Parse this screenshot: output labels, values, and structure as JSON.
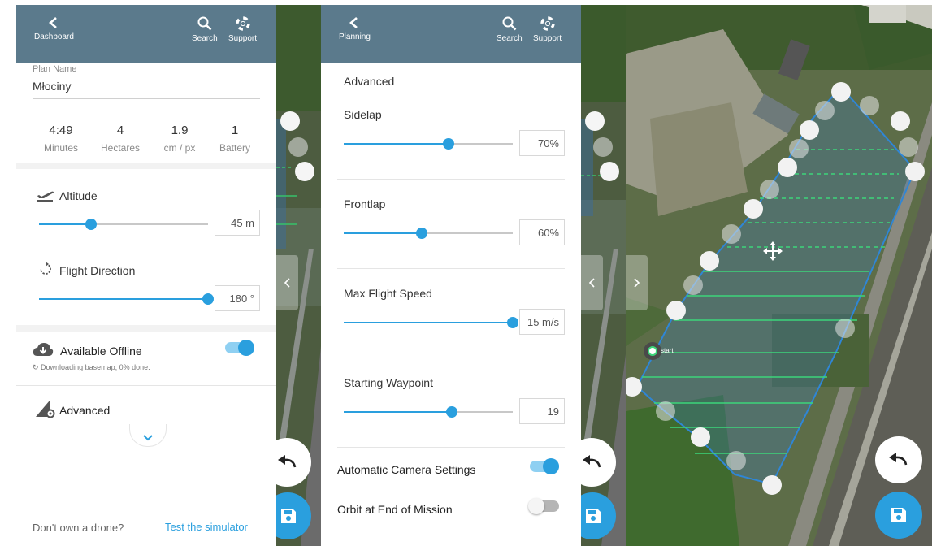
{
  "panel1": {
    "header": {
      "back_label": "Dashboard",
      "search_label": "Search",
      "support_label": "Support"
    },
    "plan_name_label": "Plan Name",
    "plan_name_value": "Młociny",
    "stats": [
      {
        "value": "4:49",
        "label": "Minutes"
      },
      {
        "value": "4",
        "label": "Hectares"
      },
      {
        "value": "1.9",
        "label": "cm / px"
      },
      {
        "value": "1",
        "label": "Battery"
      }
    ],
    "altitude": {
      "label": "Altitude",
      "value": "45 m",
      "fraction": 0.31
    },
    "flight_direction": {
      "label": "Flight Direction",
      "value": "180 °",
      "fraction": 1.0
    },
    "offline": {
      "label": "Available Offline",
      "status": "Downloading basemap, 0% done.",
      "enabled": true
    },
    "advanced_label": "Advanced",
    "footer": {
      "question": "Don't own a drone?",
      "link": "Test the simulator"
    }
  },
  "panel2": {
    "header": {
      "back_label": "Planning",
      "search_label": "Search",
      "support_label": "Support"
    },
    "section_title": "Advanced",
    "sliders": [
      {
        "label": "Sidelap",
        "value": "70%",
        "fraction": 0.62
      },
      {
        "label": "Frontlap",
        "value": "60%",
        "fraction": 0.46
      },
      {
        "label": "Max Flight Speed",
        "value": "15 m/s",
        "fraction": 1.0
      },
      {
        "label": "Starting Waypoint",
        "value": "19",
        "fraction": 0.64
      }
    ],
    "toggles": [
      {
        "label": "Automatic Camera Settings",
        "enabled": true
      },
      {
        "label": "Orbit at End of Mission",
        "enabled": false
      }
    ]
  },
  "map3": {
    "start_label": "start"
  },
  "colors": {
    "header": "#5b7a8c",
    "accent": "#2a9fde",
    "link": "#2a9fde"
  }
}
